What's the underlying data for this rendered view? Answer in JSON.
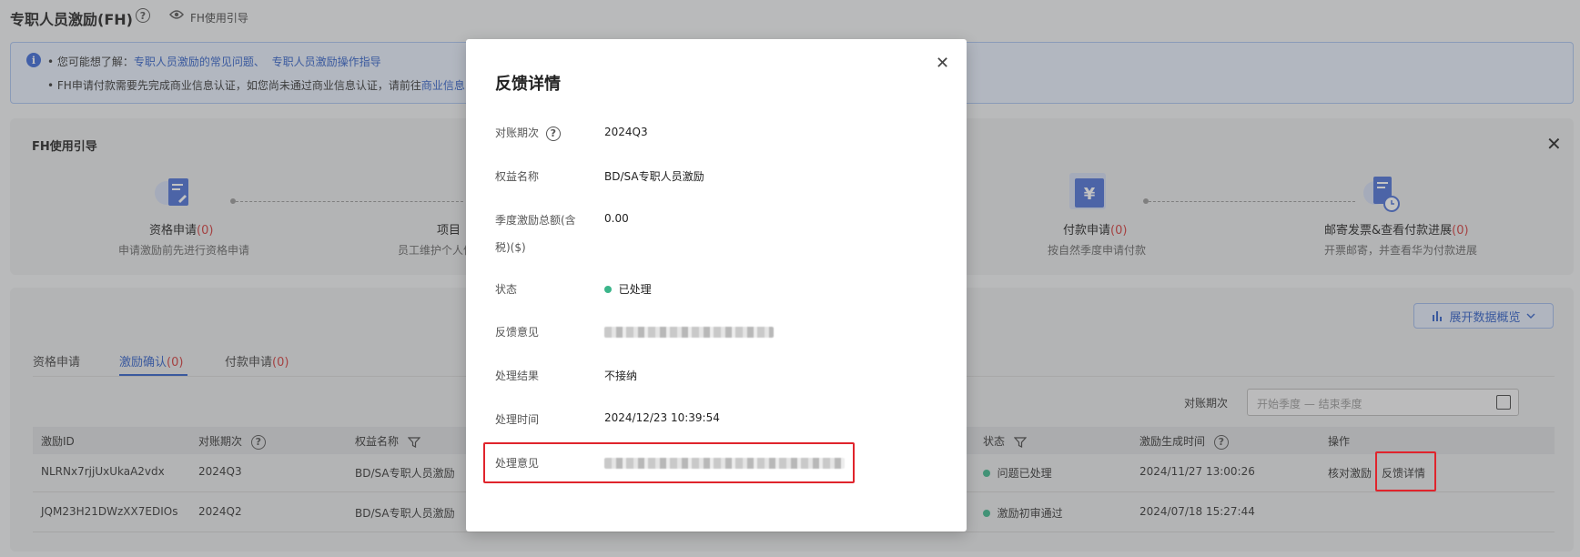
{
  "header": {
    "title": "专职人员激励(FH)",
    "guide_link": "FH使用引导"
  },
  "banner": {
    "line1_prefix": "• 您可能想了解：",
    "line1_link1": "专职人员激励的常见问题、",
    "line1_link2": "专职人员激励操作指导",
    "line2_text": "• FH申请付款需要先完成商业信息认证，如您尚未通过商业信息认证，请前往",
    "line2_link": "商业信息"
  },
  "guide": {
    "title": "FH使用引导",
    "steps": [
      {
        "title": "资格申请",
        "count": "(0)",
        "desc": "申请激励前先进行资格申请"
      },
      {
        "title": "项目",
        "count": "",
        "desc": "员工维护个人信"
      },
      {
        "title": "付款申请",
        "count": "(0)",
        "desc": "按自然季度申请付款"
      },
      {
        "title": "邮寄发票&查看付款进展",
        "count": "(0)",
        "desc": "开票邮寄，并查看华为付款进展"
      }
    ]
  },
  "main": {
    "expand_button": "展开数据概览",
    "tabs": [
      {
        "label": "资格申请",
        "count": ""
      },
      {
        "label": "激励确认",
        "count": "(0)"
      },
      {
        "label": "付款申请",
        "count": "(0)"
      }
    ],
    "period_label": "对账期次",
    "date_placeholder": "开始季度 — 结束季度",
    "columns": [
      "激励ID",
      "对账期次",
      "权益名称",
      "状态",
      "激励生成时间",
      "操作"
    ],
    "rows": [
      {
        "id": "NLRNx7rjjUxUkaA2vdx",
        "period": "2024Q3",
        "benefit": "BD/SA专职人员激励",
        "status": "问题已处理",
        "time": "2024/11/27 13:00:26",
        "action1": "核对激励",
        "action2": "反馈详情"
      },
      {
        "id": "JQM23H21DWzXX7EDIOs",
        "period": "2024Q2",
        "benefit": "BD/SA专职人员激励",
        "status": "激励初审通过",
        "time": "2024/07/18 15:27:44",
        "action1": "",
        "action2": ""
      }
    ]
  },
  "modal": {
    "title": "反馈详情",
    "fields": {
      "period_label": "对账期次",
      "period_value": "2024Q3",
      "benefit_label": "权益名称",
      "benefit_value": "BD/SA专职人员激励",
      "total_label_1": "季度激励总额(含",
      "total_label_2": "税)($)",
      "total_value": "0.00",
      "status_label": "状态",
      "status_value": "已处理",
      "feedback_label": "反馈意见",
      "result_label": "处理结果",
      "result_value": "不接纳",
      "time_label": "处理时间",
      "time_value": "2024/12/23 10:39:54",
      "opinion_label": "处理意见"
    }
  },
  "colors": {
    "link": "#2f5fc8",
    "count_red": "#d23a3a",
    "status_green": "#3bb58a",
    "highlight_red": "#e0242c"
  }
}
